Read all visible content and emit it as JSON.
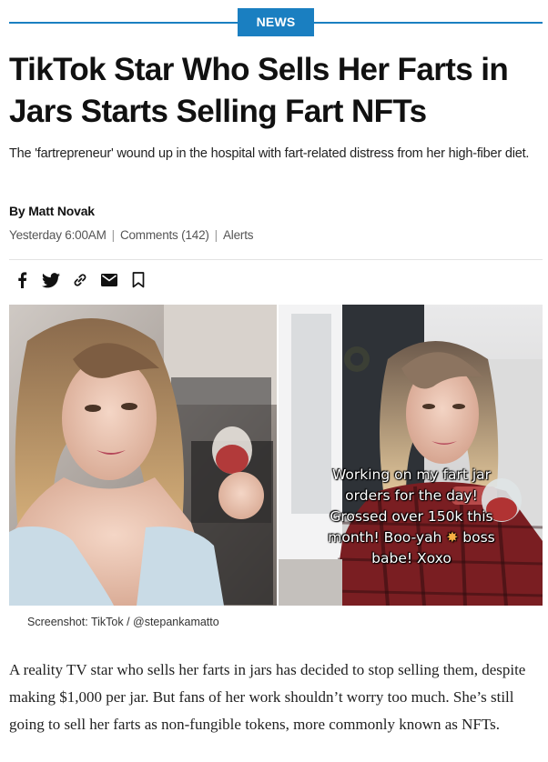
{
  "category": {
    "label": "NEWS",
    "accent": "#1a7fc1"
  },
  "article": {
    "headline": "TikTok Star Who Sells Her Farts in Jars Starts Selling Fart NFTs",
    "dek": "The 'fartrepreneur' wound up in the hospital with fart-related distress from her high-fiber diet.",
    "byline_prefix": "By ",
    "author": "Matt Novak",
    "date": "Yesterday 6:00AM",
    "comments": "Comments (142)",
    "alerts": "Alerts"
  },
  "share": {
    "icons": [
      "facebook-icon",
      "twitter-icon",
      "link-icon",
      "email-icon",
      "bookmark-icon"
    ]
  },
  "hero": {
    "overlay_text": "Working on my fart jar orders for the day! Grossed over 150k this month! Boo-yah 💥 boss babe! Xoxo",
    "overlay_line_1": "Working on my fart jar",
    "overlay_line_2": "orders for the day!",
    "overlay_line_3": "Grossed over 150k this",
    "overlay_line_4a": "month! Boo-yah",
    "overlay_line_4b": "boss",
    "overlay_line_5": "babe! Xoxo",
    "caption": "Screenshot: TikTok / @stepankamatto"
  },
  "body": {
    "paragraph_1": "A reality TV star who sells her farts in jars has decided to stop selling them, despite making $1,000 per jar. But fans of her work shouldn’t worry too much. She’s still going to sell her farts as non-fungible tokens, more commonly known as NFTs."
  }
}
